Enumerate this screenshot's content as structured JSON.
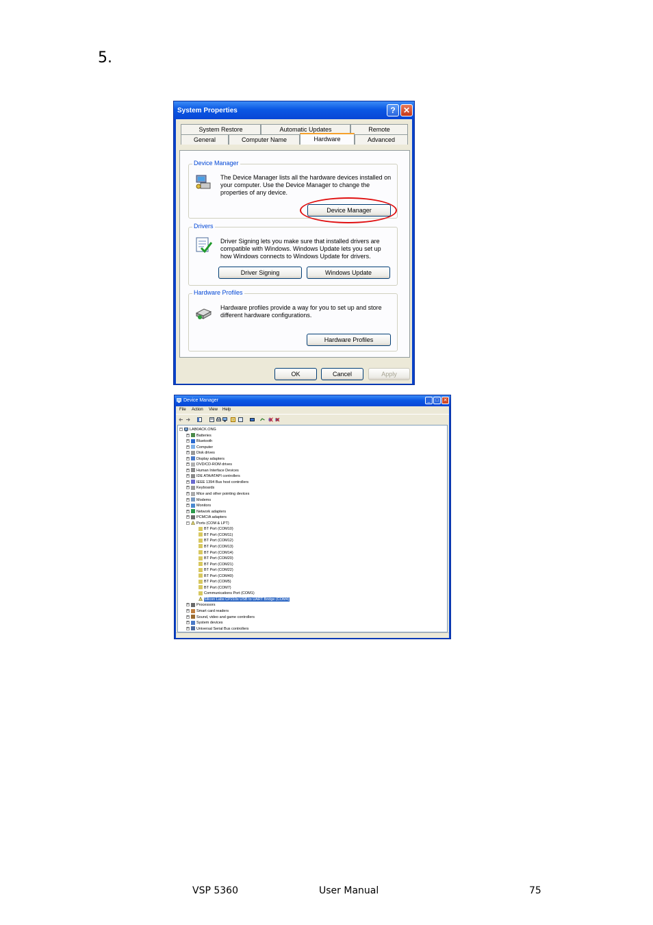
{
  "step_number": "5.",
  "system_properties": {
    "title": "System Properties",
    "help_glyph": "?",
    "close_glyph": "✕",
    "tabs_back": [
      "System Restore",
      "Automatic Updates",
      "Remote"
    ],
    "tabs_front": [
      "General",
      "Computer Name",
      "Hardware",
      "Advanced"
    ],
    "active_tab": "Hardware",
    "device_manager_group": {
      "label": "Device Manager",
      "text": "The Device Manager lists all the hardware devices installed on your computer. Use the Device Manager to change the properties of any device.",
      "button": "Device Manager"
    },
    "drivers_group": {
      "label": "Drivers",
      "text": "Driver Signing lets you make sure that installed drivers are compatible with Windows. Windows Update lets you set up how Windows connects to Windows Update for drivers.",
      "buttons": [
        "Driver Signing",
        "Windows Update"
      ]
    },
    "hardware_profiles_group": {
      "label": "Hardware Profiles",
      "text": "Hardware profiles provide a way for you to set up and store different hardware configurations.",
      "button": "Hardware Profiles"
    },
    "footer_buttons": [
      "OK",
      "Cancel",
      "Apply"
    ]
  },
  "device_manager": {
    "title": "Device Manager",
    "menu": [
      "File",
      "Action",
      "View",
      "Help"
    ],
    "tree": {
      "root": "LAB0ACK.ONG",
      "categories_before": [
        "Batteries",
        "Bluetooth",
        "Computer",
        "Disk drives",
        "Display adapters",
        "DVD/CD-ROM drives",
        "Human Interface Devices",
        "IDE ATA/ATAPI controllers",
        "IEEE 1394 Bus host controllers",
        "Keyboards",
        "Mice and other pointing devices",
        "Modems",
        "Monitors",
        "Network adapters",
        "PCMCIA adapters"
      ],
      "ports_category": "Ports (COM & LPT)",
      "ports": [
        "BT Port (COM10)",
        "BT Port (COM11)",
        "BT Port (COM12)",
        "BT Port (COM13)",
        "BT Port (COM14)",
        "BT Port (COM20)",
        "BT Port (COM21)",
        "BT Port (COM22)",
        "BT Port (COM40)",
        "BT Port (COM5)",
        "BT Port (COM7)",
        "Communications Port (COM1)"
      ],
      "selected_port": "Silicon Labs CP210x USB to UART Bridge (COM4)",
      "categories_after": [
        "Processors",
        "Smart card readers",
        "Sound, video and game controllers",
        "System devices",
        "Universal Serial Bus controllers"
      ]
    }
  },
  "footer": {
    "product": "VSP 5360",
    "doc": "User Manual",
    "page": "75"
  },
  "colors": {
    "xp_title_blue": "#0b58e4",
    "xp_face": "#ece9d8",
    "highlight_red": "#e01010",
    "selection_blue": "#316ac5"
  }
}
